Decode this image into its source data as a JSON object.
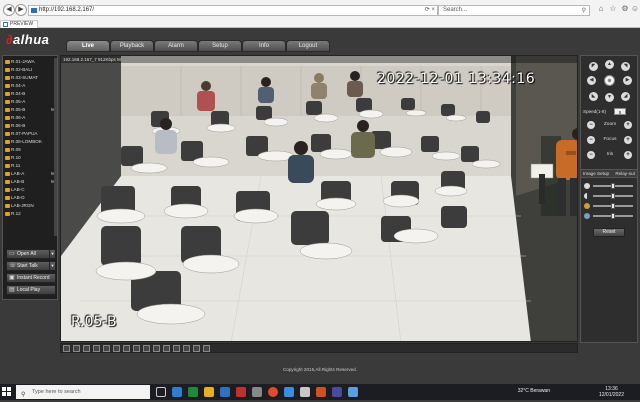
{
  "browser": {
    "url": "http://192.168.2.167/",
    "search_placeholder": "Search...",
    "tab_title": "PREVIEW"
  },
  "app": {
    "logo": "alhua",
    "nav": [
      "Live",
      "Playback",
      "Alarm",
      "Setup",
      "Info",
      "Logout"
    ],
    "active_tab": "Live"
  },
  "channels": [
    {
      "label": "R.01-JAWA",
      "tag": ""
    },
    {
      "label": "R.02-BALI",
      "tag": ""
    },
    {
      "label": "R.03-SUMAT",
      "tag": ""
    },
    {
      "label": "R.04-A",
      "tag": ""
    },
    {
      "label": "R.04-B",
      "tag": ""
    },
    {
      "label": "R.05-A",
      "tag": ""
    },
    {
      "label": "R.05-B",
      "tag": "M"
    },
    {
      "label": "R.06-A",
      "tag": ""
    },
    {
      "label": "R.06-B",
      "tag": ""
    },
    {
      "label": "R.07-PAPUA",
      "tag": ""
    },
    {
      "label": "R.08-LOMBOK",
      "tag": ""
    },
    {
      "label": "R.09",
      "tag": ""
    },
    {
      "label": "R.10",
      "tag": ""
    },
    {
      "label": "R.11",
      "tag": ""
    },
    {
      "label": "LAB-A",
      "tag": "M"
    },
    {
      "label": "LAB-B",
      "tag": "M"
    },
    {
      "label": "LAB-C",
      "tag": ""
    },
    {
      "label": "LAB-D",
      "tag": ""
    },
    {
      "label": "LAB-JRGN",
      "tag": ""
    },
    {
      "label": "R.12",
      "tag": ""
    }
  ],
  "left_buttons": {
    "open_all": "Open All",
    "start_talk": "Start Talk",
    "instant_record": "Instant Record",
    "local_play": "Local Play"
  },
  "video": {
    "header": "192.168.2.167_7  912Kbps  M",
    "timestamp": "2022-12-01  13:34:16",
    "room_label": "R.05-B"
  },
  "ptz": {
    "speed_label": "Speed(1-8)",
    "speed_value": "5",
    "zoom_label": "Zoom",
    "focus_label": "Focus",
    "iris_label": "Iris",
    "image_setup": "Image Setup",
    "relay_out": "Relay-out",
    "reset": "Reset"
  },
  "footer": "Copyright 2015,All Rights Reserved.",
  "taskbar": {
    "search_placeholder": "Type here to search",
    "weather": "32°C  Berawan",
    "time": "13:36",
    "date": "12/01/2022"
  },
  "colors": {
    "accent": "#e31b23",
    "camera_icon": "#e0a020"
  }
}
